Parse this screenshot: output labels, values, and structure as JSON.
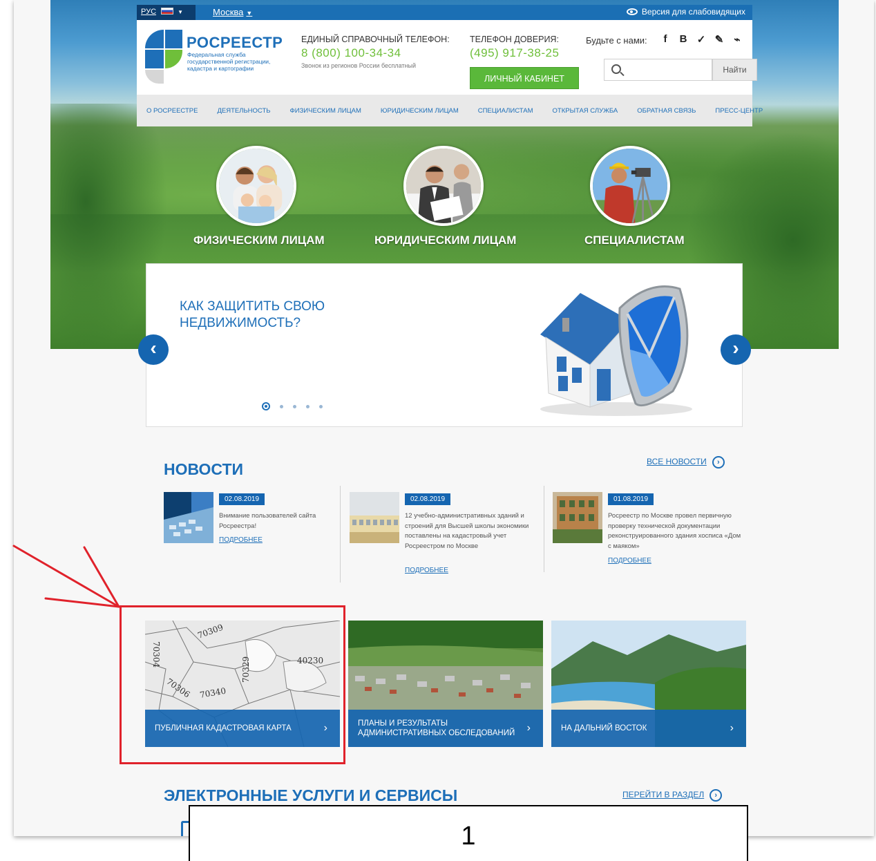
{
  "topbar": {
    "language": "РУС",
    "city": "Москва",
    "vision_version": "Версия для слабовидящих"
  },
  "header": {
    "logo_title": "РОСРЕЕСТР",
    "logo_subtitle": "Федеральная служба государственной регистрации, кадастра и картографии",
    "phone_label": "ЕДИНЫЙ СПРАВОЧНЫЙ ТЕЛЕФОН:",
    "phone_number": "8 (800) 100-34-34",
    "phone_note": "Звонок из регионов России бесплатный",
    "trust_label": "ТЕЛЕФОН ДОВЕРИЯ:",
    "trust_number": "(495) 917-38-25",
    "cabinet_button": "ЛИЧНЫЙ КАБИНЕТ",
    "social_label": "Будьте с нами:",
    "social_icons": [
      "f",
      "B",
      "t",
      "✎",
      "rss"
    ],
    "search_placeholder": "",
    "search_button": "Найти"
  },
  "menu": [
    "О РОСРЕЕСТРЕ",
    "ДЕЯТЕЛЬНОСТЬ",
    "ФИЗИЧЕСКИМ ЛИЦАМ",
    "ЮРИДИЧЕСКИМ ЛИЦАМ",
    "СПЕЦИАЛИСТАМ",
    "ОТКРЫТАЯ СЛУЖБА",
    "ОБРАТНАЯ СВЯЗЬ",
    "ПРЕСС-ЦЕНТР"
  ],
  "audiences": [
    {
      "label": "ФИЗИЧЕСКИМ ЛИЦАМ",
      "icon": "family-photo"
    },
    {
      "label": "ЮРИДИЧЕСКИМ ЛИЦАМ",
      "icon": "business-people-photo"
    },
    {
      "label": "СПЕЦИАЛИСТАМ",
      "icon": "surveyor-photo"
    }
  ],
  "slider": {
    "title": "КАК ЗАЩИТИТЬ СВОЮ НЕДВИЖИМОСТЬ?",
    "prev_icon": "chevron-left-icon",
    "next_icon": "chevron-right-icon",
    "slide_count": 5,
    "active_slide": 1
  },
  "news": {
    "title": "НОВОСТИ",
    "all_link": "ВСЕ НОВОСТИ",
    "items": [
      {
        "date": "02.08.2019",
        "text": "Внимание пользователей сайта Росреестра!",
        "more": "ПОДРОБНЕЕ"
      },
      {
        "date": "02.08.2019",
        "text": "12 учебно-административных зданий и строений для Высшей школы экономики поставлены на кадастровый учет Росреестром по Москве",
        "more": "ПОДРОБНЕЕ"
      },
      {
        "date": "01.08.2019",
        "text": "Росреестр по Москве провел первичную проверку технической документации реконструированного здания хосписа «Дом с маяком»",
        "more": "ПОДРОБНЕЕ"
      }
    ]
  },
  "tiles": [
    {
      "label": "ПУБЛИЧНАЯ КАДАСТРОВАЯ КАРТА",
      "map_labels": [
        "70304",
        "70309",
        "70329",
        "40230",
        "70306",
        "70340"
      ]
    },
    {
      "label": "ПЛАНЫ И РЕЗУЛЬТАТЫ АДМИНИСТРАТИВНЫХ ОБСЛЕДОВАНИЙ"
    },
    {
      "label": "НА ДАЛЬНИЙ ВОСТОК"
    }
  ],
  "services": {
    "title": "ЭЛЕКТРОННЫЕ УСЛУГИ И СЕРВИСЫ",
    "link": "ПЕРЕЙТИ В РАЗДЕЛ"
  },
  "caption": "1",
  "colors": {
    "brand_blue": "#1e6fb8",
    "brand_green": "#6fbf3a",
    "highlight_red": "#e0222b"
  }
}
